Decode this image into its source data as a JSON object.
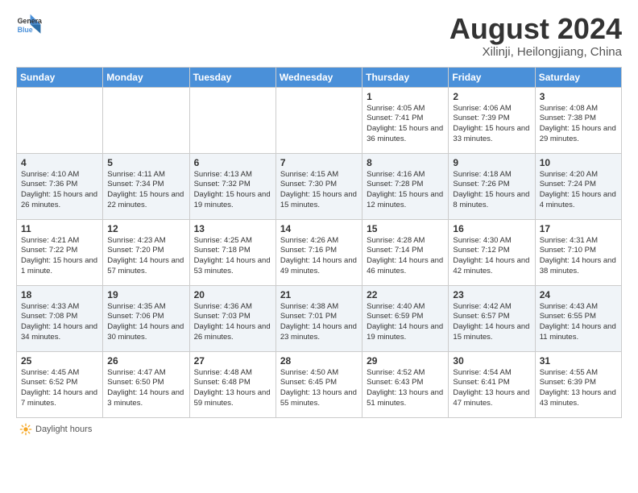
{
  "header": {
    "logo_line1": "General",
    "logo_line2": "Blue",
    "title": "August 2024",
    "subtitle": "Xilinji, Heilongjiang, China"
  },
  "weekdays": [
    "Sunday",
    "Monday",
    "Tuesday",
    "Wednesday",
    "Thursday",
    "Friday",
    "Saturday"
  ],
  "weeks": [
    [
      {
        "day": "",
        "text": ""
      },
      {
        "day": "",
        "text": ""
      },
      {
        "day": "",
        "text": ""
      },
      {
        "day": "",
        "text": ""
      },
      {
        "day": "1",
        "text": "Sunrise: 4:05 AM\nSunset: 7:41 PM\nDaylight: 15 hours\nand 36 minutes."
      },
      {
        "day": "2",
        "text": "Sunrise: 4:06 AM\nSunset: 7:39 PM\nDaylight: 15 hours\nand 33 minutes."
      },
      {
        "day": "3",
        "text": "Sunrise: 4:08 AM\nSunset: 7:38 PM\nDaylight: 15 hours\nand 29 minutes."
      }
    ],
    [
      {
        "day": "4",
        "text": "Sunrise: 4:10 AM\nSunset: 7:36 PM\nDaylight: 15 hours\nand 26 minutes."
      },
      {
        "day": "5",
        "text": "Sunrise: 4:11 AM\nSunset: 7:34 PM\nDaylight: 15 hours\nand 22 minutes."
      },
      {
        "day": "6",
        "text": "Sunrise: 4:13 AM\nSunset: 7:32 PM\nDaylight: 15 hours\nand 19 minutes."
      },
      {
        "day": "7",
        "text": "Sunrise: 4:15 AM\nSunset: 7:30 PM\nDaylight: 15 hours\nand 15 minutes."
      },
      {
        "day": "8",
        "text": "Sunrise: 4:16 AM\nSunset: 7:28 PM\nDaylight: 15 hours\nand 12 minutes."
      },
      {
        "day": "9",
        "text": "Sunrise: 4:18 AM\nSunset: 7:26 PM\nDaylight: 15 hours\nand 8 minutes."
      },
      {
        "day": "10",
        "text": "Sunrise: 4:20 AM\nSunset: 7:24 PM\nDaylight: 15 hours\nand 4 minutes."
      }
    ],
    [
      {
        "day": "11",
        "text": "Sunrise: 4:21 AM\nSunset: 7:22 PM\nDaylight: 15 hours\nand 1 minute."
      },
      {
        "day": "12",
        "text": "Sunrise: 4:23 AM\nSunset: 7:20 PM\nDaylight: 14 hours\nand 57 minutes."
      },
      {
        "day": "13",
        "text": "Sunrise: 4:25 AM\nSunset: 7:18 PM\nDaylight: 14 hours\nand 53 minutes."
      },
      {
        "day": "14",
        "text": "Sunrise: 4:26 AM\nSunset: 7:16 PM\nDaylight: 14 hours\nand 49 minutes."
      },
      {
        "day": "15",
        "text": "Sunrise: 4:28 AM\nSunset: 7:14 PM\nDaylight: 14 hours\nand 46 minutes."
      },
      {
        "day": "16",
        "text": "Sunrise: 4:30 AM\nSunset: 7:12 PM\nDaylight: 14 hours\nand 42 minutes."
      },
      {
        "day": "17",
        "text": "Sunrise: 4:31 AM\nSunset: 7:10 PM\nDaylight: 14 hours\nand 38 minutes."
      }
    ],
    [
      {
        "day": "18",
        "text": "Sunrise: 4:33 AM\nSunset: 7:08 PM\nDaylight: 14 hours\nand 34 minutes."
      },
      {
        "day": "19",
        "text": "Sunrise: 4:35 AM\nSunset: 7:06 PM\nDaylight: 14 hours\nand 30 minutes."
      },
      {
        "day": "20",
        "text": "Sunrise: 4:36 AM\nSunset: 7:03 PM\nDaylight: 14 hours\nand 26 minutes."
      },
      {
        "day": "21",
        "text": "Sunrise: 4:38 AM\nSunset: 7:01 PM\nDaylight: 14 hours\nand 23 minutes."
      },
      {
        "day": "22",
        "text": "Sunrise: 4:40 AM\nSunset: 6:59 PM\nDaylight: 14 hours\nand 19 minutes."
      },
      {
        "day": "23",
        "text": "Sunrise: 4:42 AM\nSunset: 6:57 PM\nDaylight: 14 hours\nand 15 minutes."
      },
      {
        "day": "24",
        "text": "Sunrise: 4:43 AM\nSunset: 6:55 PM\nDaylight: 14 hours\nand 11 minutes."
      }
    ],
    [
      {
        "day": "25",
        "text": "Sunrise: 4:45 AM\nSunset: 6:52 PM\nDaylight: 14 hours\nand 7 minutes."
      },
      {
        "day": "26",
        "text": "Sunrise: 4:47 AM\nSunset: 6:50 PM\nDaylight: 14 hours\nand 3 minutes."
      },
      {
        "day": "27",
        "text": "Sunrise: 4:48 AM\nSunset: 6:48 PM\nDaylight: 13 hours\nand 59 minutes."
      },
      {
        "day": "28",
        "text": "Sunrise: 4:50 AM\nSunset: 6:45 PM\nDaylight: 13 hours\nand 55 minutes."
      },
      {
        "day": "29",
        "text": "Sunrise: 4:52 AM\nSunset: 6:43 PM\nDaylight: 13 hours\nand 51 minutes."
      },
      {
        "day": "30",
        "text": "Sunrise: 4:54 AM\nSunset: 6:41 PM\nDaylight: 13 hours\nand 47 minutes."
      },
      {
        "day": "31",
        "text": "Sunrise: 4:55 AM\nSunset: 6:39 PM\nDaylight: 13 hours\nand 43 minutes."
      }
    ]
  ],
  "footer": {
    "label": "Daylight hours"
  }
}
